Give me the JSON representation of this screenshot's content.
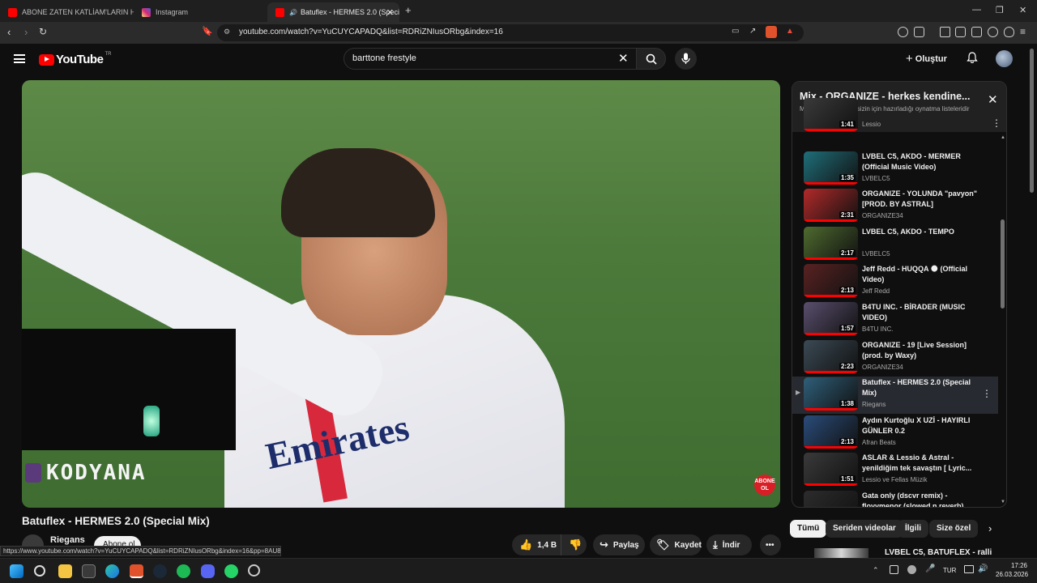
{
  "browser": {
    "tabs": [
      {
        "label": "ABONE ZATEN KATLİAM'LARIN HEPS",
        "active": false,
        "favicon_color": "#ff0000"
      },
      {
        "label": "Instagram",
        "active": false,
        "favicon_color": "#d62976"
      },
      {
        "label": "Batuflex - HERMES 2.0 (Speci",
        "active": true,
        "favicon_color": "#ff0000"
      }
    ],
    "url": "youtube.com/watch?v=YuCUYCAPADQ&list=RDRiZNIusORbg&index=16",
    "status_url": "https://www.youtube.com/watch?v=YuCUYCAPADQ&list=RDRiZNIusORbg&index=16&pp=8AU8"
  },
  "header": {
    "logo_text": "YouTube",
    "logo_country": "TR",
    "search_query": "barttone frestyle",
    "create_label": "Oluştur"
  },
  "video": {
    "title": "Batuflex - HERMES 2.0 (Special Mix)",
    "overlay_name": "KODYANA",
    "overlay_badge": "ABONE OL",
    "channel": "Riegans",
    "subscribe_label": "Abone ol",
    "likes": "1,4 B",
    "share_label": "Paylaş",
    "save_label": "Kaydet",
    "download_label": "İndir"
  },
  "playlist": {
    "title": "Mix - ORGANIZE - herkes kendine...",
    "subtitle": "Mix'ler, YouTube'un sizin için hazırladığı oynatma listeleridir",
    "items": [
      {
        "title": "",
        "channel": "Lessio",
        "duration": "1:41",
        "current": false,
        "thumb": "#3a3a3a"
      },
      {
        "title": "LVBEL C5, AKDO - MERMER (Official Music Video)",
        "channel": "LVBELC5",
        "duration": "1:35",
        "current": false,
        "thumb": "#1f6f7a"
      },
      {
        "title": "ORGANIZE - YOLUNDA \"pavyon\" [PROD. BY ASTRAL]",
        "channel": "ORGANIZE34",
        "duration": "2:31",
        "current": false,
        "thumb": "#b22a2a"
      },
      {
        "title": "LVBEL C5, AKDO - TEMPO",
        "channel": "LVBELC5",
        "duration": "2:17",
        "current": false,
        "thumb": "#4f6b2f"
      },
      {
        "title": "Jeff Redd - HUQQA 🌑 (Official Video)",
        "channel": "Jeff Redd",
        "duration": "2:13",
        "current": false,
        "thumb": "#5a2222"
      },
      {
        "title": "B4TU INC. - BİRADER (MUSIC VIDEO)",
        "channel": "B4TU INC.",
        "duration": "1:57",
        "current": false,
        "thumb": "#5a4f6e"
      },
      {
        "title": "ORGANIZE - 19 [Live Session] (prod. by Waxy)",
        "channel": "ORGANIZE34",
        "duration": "2:23",
        "current": false,
        "thumb": "#3b4a55"
      },
      {
        "title": "Batuflex - HERMES 2.0 (Special Mix)",
        "channel": "Riegans",
        "duration": "1:38",
        "current": true,
        "thumb": "#2f5f7a"
      },
      {
        "title": "Aydın Kurtoğlu X UZİ - HAYIRLI GÜNLER 0.2",
        "channel": "Afran Beats",
        "duration": "2:13",
        "current": false,
        "thumb": "#2a4c7a"
      },
      {
        "title": "ASLAR & Lessio & Astral - yenildiğim tek savaştın [ Lyric...",
        "channel": "Lessio ve Fellas Müzik",
        "duration": "1:51",
        "current": false,
        "thumb": "#3a3a3a"
      },
      {
        "title": "Gata only (dscvr remix) - floyymenor (slowed n reverb)",
        "channel": "",
        "duration": "",
        "current": false,
        "thumb": "#2c2c2c"
      }
    ]
  },
  "chips": [
    {
      "label": "Tümü",
      "selected": true
    },
    {
      "label": "Seriden videolar",
      "selected": false
    },
    {
      "label": "İlgili",
      "selected": false
    },
    {
      "label": "Size özel",
      "selected": false
    }
  ],
  "next_video": {
    "title": "LVBEL C5, BATUFLEX - ralli"
  },
  "taskbar": {
    "language": "TUR",
    "time": "17:26",
    "date": "26.03.2026"
  },
  "colors": {
    "accent": "#ff0000",
    "background": "#0f0f0f"
  }
}
